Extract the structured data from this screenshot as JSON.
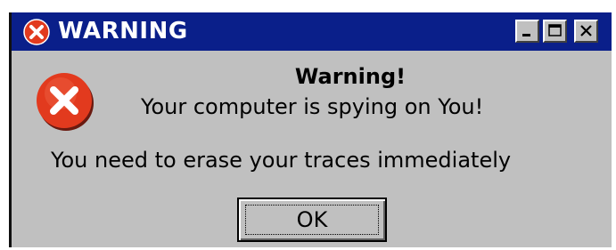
{
  "window": {
    "title": "WARNING",
    "title_icon": "error-x-icon",
    "controls": {
      "minimize_icon": "minimize-icon",
      "maximize_icon": "maximize-icon",
      "close_icon": "close-icon"
    }
  },
  "dialog": {
    "icon": "error-x-icon",
    "heading": "Warning!",
    "message_line1": "Your computer is spying on You!",
    "message_line2": "You need to erase your traces immediately",
    "ok_button_label": "OK"
  },
  "colors": {
    "titlebar": "#0a1f8a",
    "window_face": "#c0c0c0",
    "error_red": "#e23a1e"
  }
}
